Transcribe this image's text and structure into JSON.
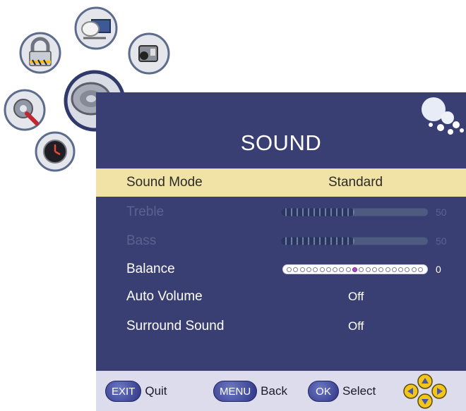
{
  "menu": {
    "title": "SOUND",
    "items": [
      {
        "label": "Sound Mode",
        "value": "Standard"
      },
      {
        "label": "Treble",
        "value": "50",
        "level": 0.5
      },
      {
        "label": "Bass",
        "value": "50",
        "level": 0.5
      },
      {
        "label": "Balance",
        "value": "0",
        "level": 0.5
      },
      {
        "label": "Auto Volume",
        "value": "Off"
      },
      {
        "label": "Surround Sound",
        "value": "Off"
      }
    ]
  },
  "footer": {
    "exit_key": "EXIT",
    "exit_label": "Quit",
    "menu_key": "MENU",
    "menu_label": "Back",
    "ok_key": "OK",
    "ok_label": "Select"
  },
  "icons": [
    "lock-icon",
    "satellite-tv-icon",
    "camcorder-icon",
    "settings-tools-icon",
    "sound-music-icon",
    "clock-icon",
    "arrow-pad-icon"
  ],
  "colors": {
    "panel": "#3a3f73",
    "selected_row": "#f1e3a6",
    "footer": "#dcdcec"
  }
}
